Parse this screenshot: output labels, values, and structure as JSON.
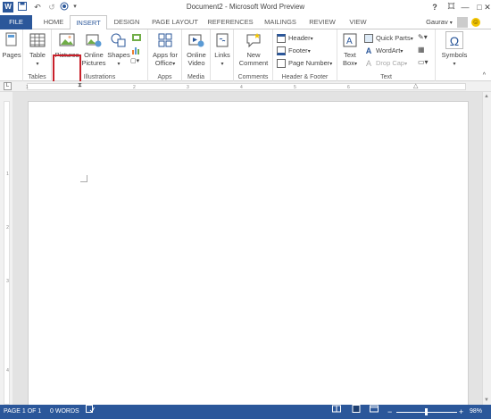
{
  "window": {
    "title": "Document2 - Microsoft Word Preview",
    "help": "?",
    "restore": "□",
    "minimize": "—",
    "close": "✕"
  },
  "qat": {
    "word_icon": "W",
    "save": "💾",
    "undo": "↶",
    "redo": "↺",
    "customize": "▾"
  },
  "tabs": [
    "FILE",
    "HOME",
    "INSERT",
    "DESIGN",
    "PAGE LAYOUT",
    "REFERENCES",
    "MAILINGS",
    "REVIEW",
    "VIEW"
  ],
  "user": {
    "name": "Gaurav",
    "caret": "▾",
    "smiley": "☺"
  },
  "ribbon": {
    "pages": {
      "label": "Pages"
    },
    "tables": {
      "table": "Table",
      "group": "Tables"
    },
    "illustrations": {
      "pictures": "Pictures",
      "online_pictures_1": "Online",
      "online_pictures_2": "Pictures",
      "shapes": "Shapes",
      "group": "Illustrations"
    },
    "apps": {
      "apps_1": "Apps for",
      "apps_2": "Office",
      "group": "Apps"
    },
    "media": {
      "video_1": "Online",
      "video_2": "Video",
      "group": "Media"
    },
    "links": {
      "links": "Links"
    },
    "comments": {
      "new_1": "New",
      "new_2": "Comment",
      "group": "Comments"
    },
    "header_footer": {
      "header": "Header",
      "footer": "Footer",
      "page_number": "Page Number",
      "group": "Header & Footer"
    },
    "text": {
      "textbox_1": "Text",
      "textbox_2": "Box",
      "quick_parts": "Quick Parts",
      "wordart": "WordArt",
      "drop_cap": "Drop Cap",
      "group": "Text"
    },
    "symbols": {
      "symbols": "Symbols",
      "omega": "Ω"
    }
  },
  "ruler": {
    "corner": "L",
    "numbers": [
      "1",
      "2",
      "3",
      "4",
      "5",
      "6"
    ]
  },
  "vruler": {
    "numbers": [
      "1",
      "2",
      "3",
      "4"
    ]
  },
  "status": {
    "page": "PAGE 1 OF 1",
    "words": "0 WORDS",
    "zoom_minus": "−",
    "zoom_plus": "+",
    "zoom": "98%"
  },
  "colors": {
    "accent": "#2b579a",
    "highlight": "#c8202a"
  }
}
